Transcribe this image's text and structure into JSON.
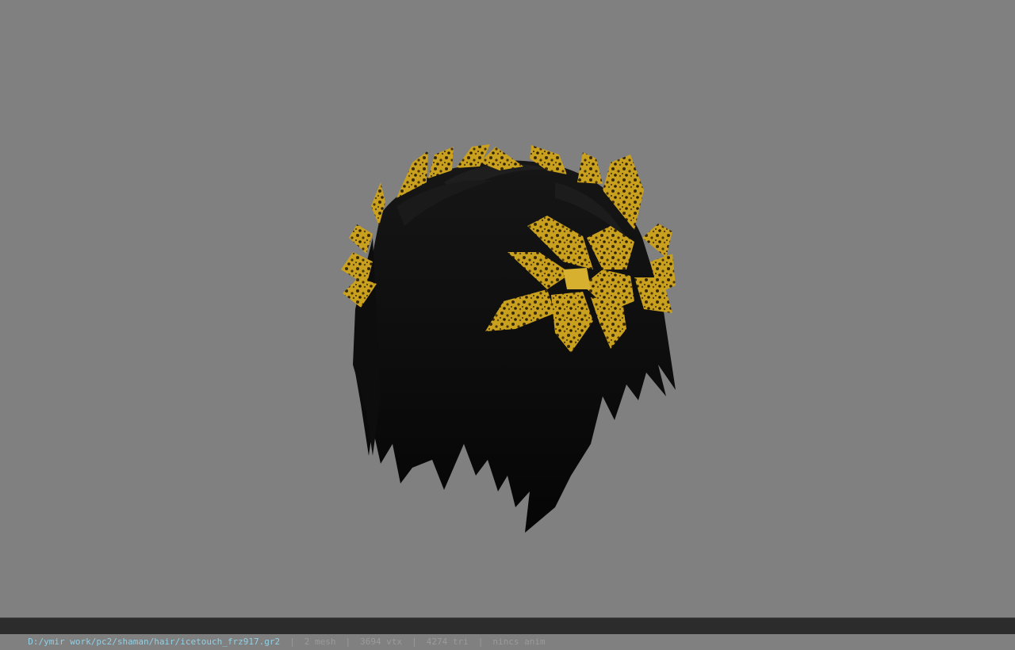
{
  "viewport": {
    "background_color": "#808080",
    "model": {
      "hair_color": "#0b0b0b",
      "leaf_color": "#c8a020",
      "leaf_dark_color": "#3a2a05"
    }
  },
  "status_bar": {
    "file_path": "D:/ymir work/pc2/shaman/hair/icetouch_frz917.gr2",
    "separator": "|",
    "mesh": "2 mesh",
    "vertices": "3694 vtx",
    "triangles": "4274 tri",
    "animation": "nincs anim"
  }
}
